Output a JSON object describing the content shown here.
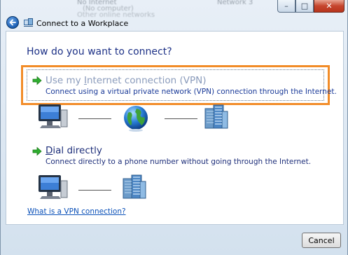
{
  "background": {
    "col1": [
      "No Internet",
      "(No computer)",
      "Other online networks"
    ],
    "col2": [
      "Network 3"
    ]
  },
  "window": {
    "title": "Connect to a Workplace",
    "minimize_glyph": "–",
    "maximize_glyph": "□",
    "close_glyph": "✕"
  },
  "main": {
    "heading": "How do you want to connect?",
    "options": [
      {
        "title_prefix": "Use my ",
        "title_accel": "I",
        "title_suffix": "nternet connection (VPN)",
        "description": "Connect using a virtual private network (VPN) connection through the Internet."
      },
      {
        "title_prefix": "",
        "title_accel": "D",
        "title_suffix": "ial directly",
        "description": "Connect directly to a phone number without going through the Internet."
      }
    ],
    "help_link": "What is a VPN connection?"
  },
  "footer": {
    "cancel_label": "Cancel"
  },
  "colors": {
    "highlight": "#f28c28",
    "heading": "#1e3287",
    "link": "#0a50b8"
  },
  "icons": [
    "back-arrow-icon",
    "wizard-icon",
    "green-arrow-icon",
    "computer-icon",
    "globe-icon",
    "office-building-icon"
  ]
}
